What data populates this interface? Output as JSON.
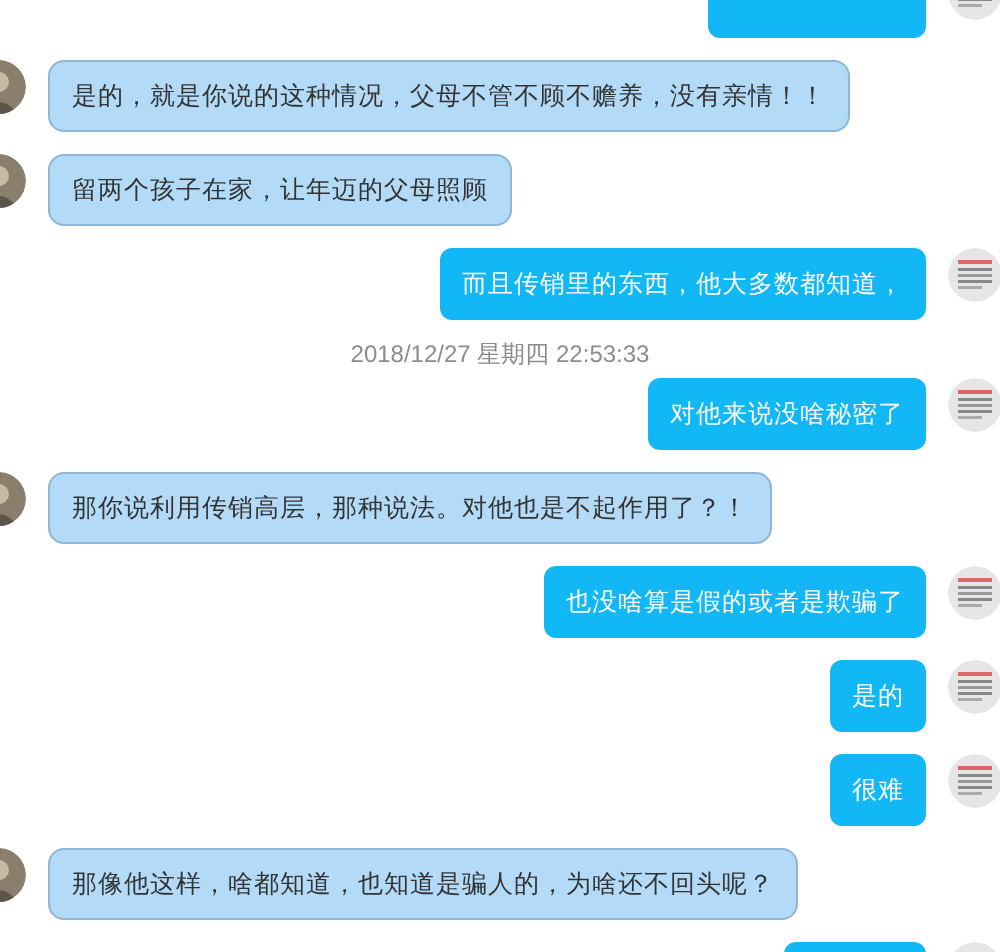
{
  "messages": [
    {
      "kind": "clipped_outgoing"
    },
    {
      "kind": "incoming",
      "text": "是的，就是你说的这种情况，父母不管不顾不赡养，没有亲情！！"
    },
    {
      "kind": "incoming",
      "text": "留两个孩子在家，让年迈的父母照顾"
    },
    {
      "kind": "outgoing",
      "text": "而且传销里的东西，他大多数都知道，"
    },
    {
      "kind": "time",
      "text": "2018/12/27 星期四 22:53:33"
    },
    {
      "kind": "outgoing",
      "text": "对他来说没啥秘密了"
    },
    {
      "kind": "incoming",
      "text": "那你说利用传销高层，那种说法。对他也是不起作用了？！"
    },
    {
      "kind": "outgoing",
      "text": "也没啥算是假的或者是欺骗了"
    },
    {
      "kind": "outgoing",
      "text": "是的"
    },
    {
      "kind": "outgoing",
      "text": "很难"
    },
    {
      "kind": "incoming",
      "text": "那像他这样，啥都知道，也知道是骗人的，为啥还不回头呢？"
    },
    {
      "kind": "clipped_outgoing"
    }
  ]
}
